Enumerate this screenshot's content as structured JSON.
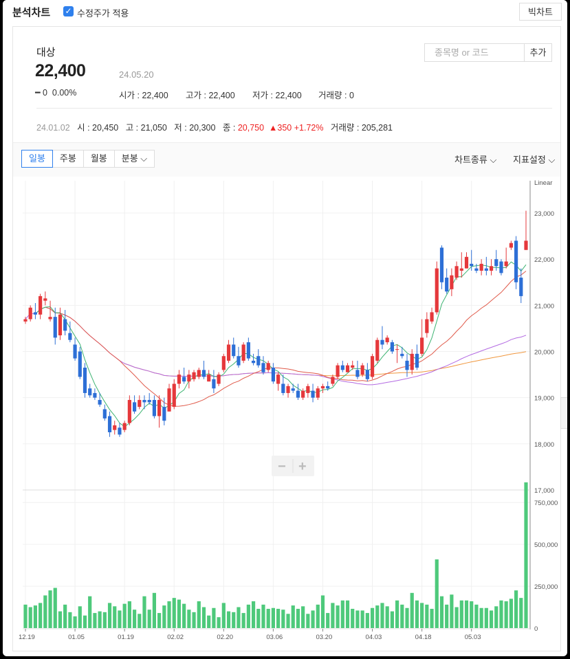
{
  "header": {
    "title": "분석차트",
    "adjusted_label": "수정주가 적용",
    "big_chart_label": "빅차트"
  },
  "stock": {
    "name": "대상",
    "price": "22,400",
    "date": "24.05.20",
    "change": "0",
    "change_pct": "0.00%",
    "open_label": "시가",
    "open": "22,400",
    "high_label": "고가",
    "high": "22,400",
    "low_label": "저가",
    "low": "22,400",
    "volume_label": "거래량",
    "volume": "0"
  },
  "search": {
    "placeholder": "종목명 or 코드",
    "add_label": "추가"
  },
  "hover_info": {
    "date": "24.01.02",
    "open_label": "시",
    "open": "20,450",
    "high_label": "고",
    "high": "21,050",
    "low_label": "저",
    "low": "20,300",
    "close_label": "종",
    "close": "20,750",
    "change": "▲350",
    "change_pct": "+1.72%",
    "volume_label": "거래량",
    "volume": "205,281"
  },
  "toolbar": {
    "tabs": [
      "일봉",
      "주봉",
      "월봉",
      "분봉"
    ],
    "chart_type_label": "차트종류",
    "indicator_label": "지표설정"
  },
  "chart_data": {
    "type": "candlestick",
    "scale_label": "Linear",
    "price_axis": {
      "ticks": [
        "23,000",
        "22,000",
        "21,000",
        "20,000",
        "19,000",
        "18,000",
        "17,000"
      ],
      "range": [
        17000,
        23700
      ]
    },
    "volume_axis": {
      "ticks": [
        "750,000",
        "500,000",
        "250,000",
        "0"
      ],
      "range": [
        0,
        800000
      ]
    },
    "x_labels": [
      {
        "i": 0,
        "label": "12.19"
      },
      {
        "i": 10,
        "label": "01.05"
      },
      {
        "i": 20,
        "label": "01.19"
      },
      {
        "i": 30,
        "label": "02.02"
      },
      {
        "i": 40,
        "label": "02.20"
      },
      {
        "i": 50,
        "label": "03.06"
      },
      {
        "i": 60,
        "label": "03.20"
      },
      {
        "i": 70,
        "label": "04.03"
      },
      {
        "i": 80,
        "label": "04.18"
      },
      {
        "i": 90,
        "label": "05.03"
      }
    ],
    "colors": {
      "up": "#e5383b",
      "down": "#2d6fd6",
      "volume": "#4ec97b",
      "ma5": "#3cb371",
      "ma20": "#e05a4a",
      "ma60": "#b36ae2",
      "ma120": "#f0963c"
    },
    "candles": [
      [
        20650,
        20750,
        20600,
        20700
      ],
      [
        20700,
        21000,
        20650,
        20950
      ],
      [
        20850,
        21050,
        20700,
        20800
      ],
      [
        20800,
        21250,
        20700,
        21200
      ],
      [
        21100,
        21300,
        21000,
        21150
      ],
      [
        20700,
        21100,
        20650,
        20750
      ],
      [
        20750,
        20950,
        20150,
        20300
      ],
      [
        20350,
        20950,
        20250,
        20800
      ],
      [
        20700,
        20900,
        20350,
        20450
      ],
      [
        20400,
        20650,
        20200,
        20250
      ],
      [
        20150,
        20300,
        19800,
        19850
      ],
      [
        20000,
        20100,
        19400,
        19450
      ],
      [
        19650,
        19750,
        19000,
        19100
      ],
      [
        19200,
        19300,
        19000,
        19050
      ],
      [
        19100,
        19200,
        18950,
        19000
      ],
      [
        18950,
        19100,
        18800,
        18850
      ],
      [
        18750,
        18850,
        18500,
        18550
      ],
      [
        18600,
        18700,
        18150,
        18250
      ],
      [
        18300,
        18500,
        18200,
        18400
      ],
      [
        18350,
        18450,
        18150,
        18200
      ],
      [
        18300,
        18500,
        18250,
        18450
      ],
      [
        18450,
        19050,
        18400,
        18950
      ],
      [
        18900,
        19050,
        18650,
        18700
      ],
      [
        18800,
        19050,
        18750,
        18950
      ],
      [
        18950,
        19050,
        18750,
        18900
      ],
      [
        18950,
        19100,
        18850,
        18900
      ],
      [
        18950,
        19050,
        18550,
        18600
      ],
      [
        18600,
        19050,
        18350,
        18950
      ],
      [
        18800,
        19000,
        18400,
        18500
      ],
      [
        18700,
        19300,
        18700,
        19200
      ],
      [
        18800,
        19400,
        18750,
        19300
      ],
      [
        19300,
        19600,
        19200,
        19500
      ],
      [
        19450,
        19650,
        19300,
        19350
      ],
      [
        19350,
        19600,
        19200,
        19500
      ],
      [
        19400,
        19600,
        19350,
        19550
      ],
      [
        19450,
        19650,
        19400,
        19600
      ],
      [
        19600,
        19800,
        19400,
        19450
      ],
      [
        19350,
        19600,
        19350,
        19500
      ],
      [
        19400,
        19600,
        19100,
        19200
      ],
      [
        19300,
        19550,
        19250,
        19500
      ],
      [
        19600,
        19950,
        19550,
        19900
      ],
      [
        19800,
        20250,
        19750,
        20150
      ],
      [
        20150,
        20300,
        19850,
        19900
      ],
      [
        19900,
        20100,
        19650,
        19700
      ],
      [
        19800,
        20200,
        19750,
        20150
      ],
      [
        20200,
        20300,
        19800,
        19850
      ],
      [
        19800,
        19950,
        19700,
        19750
      ],
      [
        19900,
        20050,
        19650,
        19700
      ],
      [
        19750,
        19900,
        19500,
        19550
      ],
      [
        19600,
        19800,
        19550,
        19750
      ],
      [
        19650,
        19750,
        19300,
        19350
      ],
      [
        19300,
        19550,
        19150,
        19500
      ],
      [
        19300,
        19500,
        19050,
        19100
      ],
      [
        19100,
        19300,
        19000,
        19250
      ],
      [
        19200,
        19300,
        19100,
        19150
      ],
      [
        19150,
        19300,
        18950,
        19000
      ],
      [
        19000,
        19200,
        18950,
        19150
      ],
      [
        19100,
        19300,
        19000,
        19250
      ],
      [
        19150,
        19300,
        18900,
        19000
      ],
      [
        19000,
        19250,
        18950,
        19200
      ],
      [
        19200,
        19300,
        19100,
        19250
      ],
      [
        19250,
        19350,
        19150,
        19200
      ],
      [
        19300,
        19500,
        19250,
        19450
      ],
      [
        19450,
        19750,
        19400,
        19700
      ],
      [
        19700,
        19800,
        19550,
        19600
      ],
      [
        19550,
        19750,
        19550,
        19700
      ],
      [
        19650,
        19800,
        19600,
        19700
      ],
      [
        19600,
        19800,
        19400,
        19450
      ],
      [
        19500,
        19750,
        19450,
        19700
      ],
      [
        19600,
        19750,
        19350,
        19400
      ],
      [
        19450,
        19950,
        19400,
        19900
      ],
      [
        19800,
        20300,
        19750,
        20250
      ],
      [
        20250,
        20550,
        20050,
        20150
      ],
      [
        20200,
        20350,
        20150,
        20300
      ],
      [
        20200,
        20250,
        19950,
        20000
      ],
      [
        20050,
        20150,
        19750,
        20050
      ],
      [
        19950,
        20100,
        19850,
        19900
      ],
      [
        19800,
        19950,
        19450,
        19600
      ],
      [
        19600,
        20050,
        19500,
        19950
      ],
      [
        19950,
        20150,
        19600,
        19650
      ],
      [
        19950,
        20700,
        19900,
        20300
      ],
      [
        20400,
        20850,
        20300,
        20700
      ],
      [
        20650,
        20950,
        20600,
        20850
      ],
      [
        20850,
        21950,
        20800,
        21800
      ],
      [
        22250,
        22300,
        21350,
        21500
      ],
      [
        21600,
        21800,
        21250,
        21300
      ],
      [
        21350,
        21800,
        21200,
        21650
      ],
      [
        21600,
        21950,
        21550,
        21850
      ],
      [
        21750,
        22150,
        21600,
        21800
      ],
      [
        21800,
        22150,
        21800,
        22050
      ],
      [
        21900,
        22200,
        21750,
        21850
      ],
      [
        21800,
        21900,
        21700,
        21750
      ],
      [
        21750,
        22000,
        21650,
        21900
      ],
      [
        21800,
        22050,
        21650,
        21750
      ],
      [
        21750,
        22000,
        21650,
        21850
      ],
      [
        22000,
        22200,
        21750,
        21850
      ],
      [
        21950,
        22000,
        21650,
        21700
      ],
      [
        21850,
        22250,
        21800,
        21950
      ],
      [
        22250,
        22400,
        22200,
        22350
      ],
      [
        22400,
        22500,
        21350,
        21500
      ],
      [
        21600,
        21800,
        21050,
        21200
      ],
      [
        22200,
        23050,
        22200,
        22400
      ]
    ],
    "volumes": [
      140000,
      125000,
      135000,
      150000,
      195000,
      225000,
      240000,
      100000,
      140000,
      95000,
      70000,
      130000,
      75000,
      190000,
      90000,
      100000,
      95000,
      150000,
      130000,
      105000,
      145000,
      160000,
      110000,
      85000,
      190000,
      110000,
      210000,
      90000,
      135000,
      160000,
      180000,
      170000,
      145000,
      110000,
      95000,
      160000,
      125000,
      75000,
      120000,
      65000,
      150000,
      100000,
      95000,
      125000,
      90000,
      140000,
      160000,
      115000,
      140000,
      115000,
      120000,
      115000,
      110000,
      85000,
      135000,
      115000,
      130000,
      85000,
      105000,
      140000,
      195000,
      90000,
      150000,
      135000,
      165000,
      165000,
      115000,
      105000,
      105000,
      90000,
      120000,
      135000,
      150000,
      130000,
      100000,
      165000,
      140000,
      120000,
      210000,
      165000,
      150000,
      140000,
      115000,
      410000,
      190000,
      140000,
      200000,
      125000,
      165000,
      165000,
      160000,
      140000,
      120000,
      120000,
      105000,
      130000,
      165000,
      160000,
      175000,
      225000,
      180000,
      870000
    ]
  }
}
